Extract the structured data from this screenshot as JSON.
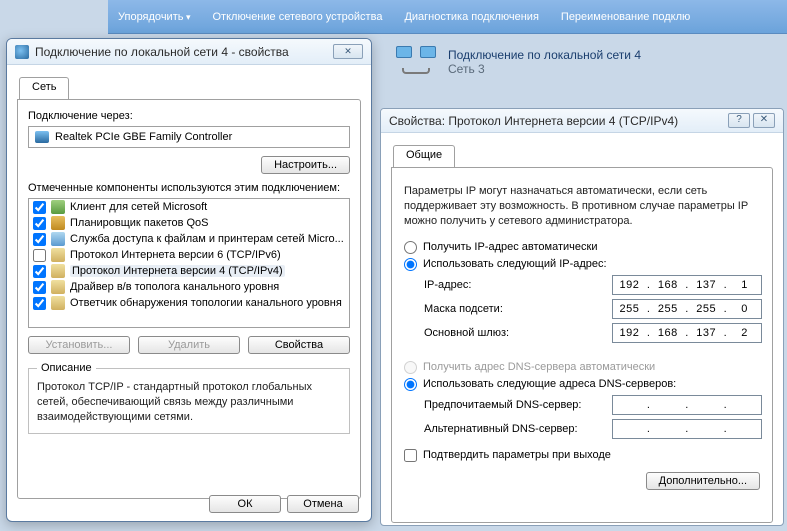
{
  "toolbar": {
    "organize": "Упорядочить",
    "disable": "Отключение сетевого устройства",
    "diag": "Диагностика подключения",
    "rename": "Переименование подклю"
  },
  "netblock": {
    "title": "Подключение по локальной сети 4",
    "subtitle": "Сеть 3"
  },
  "dlg1": {
    "title": "Подключение по локальной сети 4 - свойства",
    "tab": "Сеть",
    "connect_via": "Подключение через:",
    "adapter": "Realtek PCIe GBE Family Controller",
    "configure": "Настроить...",
    "components_label": "Отмеченные компоненты используются этим подключением:",
    "items": [
      {
        "checked": true,
        "icon": "ic-client",
        "label": "Клиент для сетей Microsoft"
      },
      {
        "checked": true,
        "icon": "ic-sched",
        "label": "Планировщик пакетов QoS"
      },
      {
        "checked": true,
        "icon": "ic-share",
        "label": "Служба доступа к файлам и принтерам сетей Micro..."
      },
      {
        "checked": false,
        "icon": "ic-proto",
        "label": "Протокол Интернета версии 6 (TCP/IPv6)"
      },
      {
        "checked": true,
        "icon": "ic-proto",
        "label": "Протокол Интернета версии 4 (TCP/IPv4)",
        "selected": true
      },
      {
        "checked": true,
        "icon": "ic-proto",
        "label": "Драйвер в/в тополога канального уровня"
      },
      {
        "checked": true,
        "icon": "ic-proto",
        "label": "Ответчик обнаружения топологии канального уровня"
      }
    ],
    "install": "Установить...",
    "uninstall": "Удалить",
    "properties": "Свойства",
    "desc_legend": "Описание",
    "desc_text": "Протокол TCP/IP - стандартный протокол глобальных сетей, обеспечивающий связь между различными взаимодействующими сетями.",
    "ok": "ОК",
    "cancel": "Отмена"
  },
  "dlg2": {
    "title": "Свойства: Протокол Интернета версии 4 (TCP/IPv4)",
    "tab": "Общие",
    "info": "Параметры IP могут назначаться автоматически, если сеть поддерживает эту возможность. В противном случае параметры IP можно получить у сетевого администратора.",
    "r_ip_auto": "Получить IP-адрес автоматически",
    "r_ip_manual": "Использовать следующий IP-адрес:",
    "ip_label": "IP-адрес:",
    "ip": [
      "192",
      "168",
      "137",
      "1"
    ],
    "mask_label": "Маска подсети:",
    "mask": [
      "255",
      "255",
      "255",
      "0"
    ],
    "gw_label": "Основной шлюз:",
    "gw": [
      "192",
      "168",
      "137",
      "2"
    ],
    "r_dns_auto": "Получить адрес DNS-сервера автоматически",
    "r_dns_manual": "Использовать следующие адреса DNS-серверов:",
    "dns1_label": "Предпочитаемый DNS-сервер:",
    "dns1": [
      "",
      "",
      "",
      ""
    ],
    "dns2_label": "Альтернативный DNS-сервер:",
    "dns2": [
      "",
      "",
      "",
      ""
    ],
    "validate": "Подтвердить параметры при выходе",
    "advanced": "Дополнительно..."
  }
}
